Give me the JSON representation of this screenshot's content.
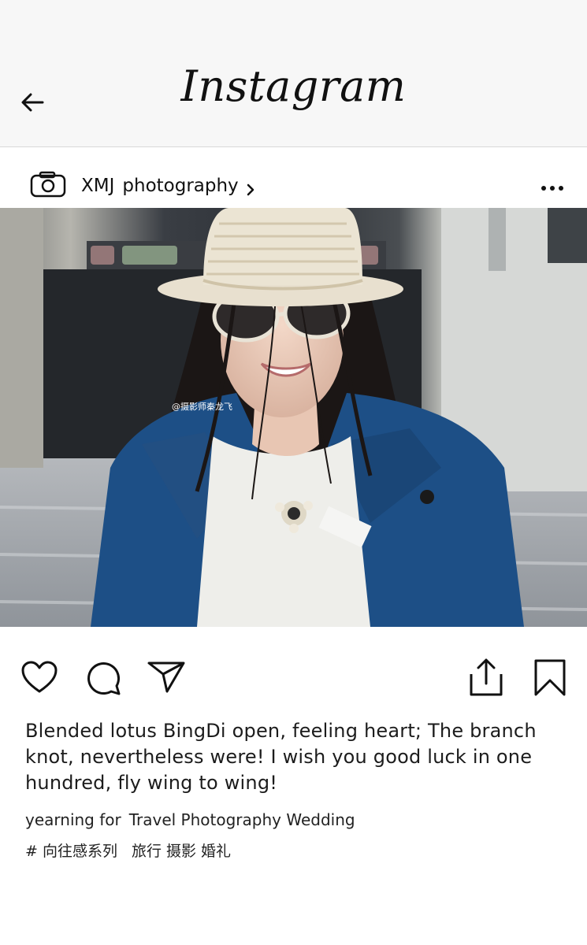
{
  "header": {
    "logo_text": "Instagram",
    "back_icon": "arrow-left-icon"
  },
  "post": {
    "account_icon": "camera-icon",
    "account_name": "XMJ",
    "account_sub": "photography",
    "chevron": "›",
    "more_icon": "more-dots-icon",
    "watermark": "@摄影师秦龙飞"
  },
  "actions": {
    "icons": [
      "heart-icon",
      "comment-icon",
      "share-icon",
      "upload-icon",
      "bookmark-icon"
    ]
  },
  "caption": {
    "text": "Blended lotus BingDi open, feeling heart; The branch knot, nevertheless were! I wish you good luck in one hundred, fly wing to wing!",
    "tags_prefix": "yearning for",
    "tags_topics": "Travel Photography Wedding",
    "hashtag_line": "# 向往感系列",
    "hashtag_cn": "旅行 摄影 婚礼"
  },
  "colors": {
    "coat": "#1d4f86",
    "background": "#ffffff",
    "topbar": "#f7f7f7"
  }
}
